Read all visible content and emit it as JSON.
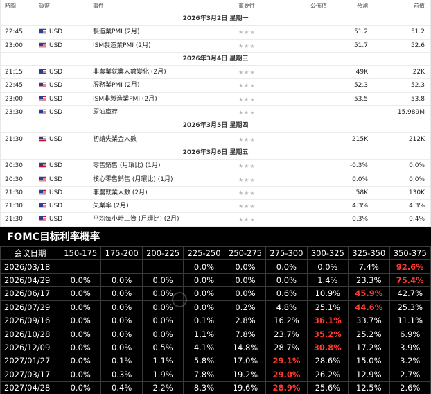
{
  "calendar": {
    "headers": {
      "time": "時間",
      "currency": "貨幣",
      "event": "事件",
      "importance": "重要性",
      "actual": "公佈值",
      "forecast": "預測",
      "previous": "前值"
    },
    "importance_glyph": "★★★",
    "rows": [
      {
        "type": "date",
        "label": "2026年3月2日 星期一"
      },
      {
        "type": "event",
        "time": "22:45",
        "currency": "USD",
        "event": "製造業PMI (2月)",
        "actual": "",
        "forecast": "51.2",
        "previous": "51.2"
      },
      {
        "type": "event",
        "time": "23:00",
        "currency": "USD",
        "event": "ISM製造業PMI (2月)",
        "actual": "",
        "forecast": "51.7",
        "previous": "52.6"
      },
      {
        "type": "date",
        "label": "2026年3月4日 星期三"
      },
      {
        "type": "event",
        "time": "21:15",
        "currency": "USD",
        "event": "非農業就業人數變化 (2月)",
        "actual": "",
        "forecast": "49K",
        "previous": "22K"
      },
      {
        "type": "event",
        "time": "22:45",
        "currency": "USD",
        "event": "服務業PMI (2月)",
        "actual": "",
        "forecast": "52.3",
        "previous": "52.3"
      },
      {
        "type": "event",
        "time": "23:00",
        "currency": "USD",
        "event": "ISM非製造業PMI (2月)",
        "actual": "",
        "forecast": "53.5",
        "previous": "53.8"
      },
      {
        "type": "event",
        "time": "23:30",
        "currency": "USD",
        "event": "原油庫存",
        "actual": "",
        "forecast": "",
        "previous": "15.989M"
      },
      {
        "type": "date",
        "label": "2026年3月5日 星期四"
      },
      {
        "type": "event",
        "time": "21:30",
        "currency": "USD",
        "event": "初請失業金人數",
        "actual": "",
        "forecast": "215K",
        "previous": "212K"
      },
      {
        "type": "date",
        "label": "2026年3月6日 星期五"
      },
      {
        "type": "event",
        "time": "20:30",
        "currency": "USD",
        "event": "零售銷售 (月環比) (1月)",
        "actual": "",
        "forecast": "-0.3%",
        "previous": "0.0%"
      },
      {
        "type": "event",
        "time": "20:30",
        "currency": "USD",
        "event": "核心零售銷售 (月環比) (1月)",
        "actual": "",
        "forecast": "0.0%",
        "previous": "0.0%"
      },
      {
        "type": "event",
        "time": "21:30",
        "currency": "USD",
        "event": "非農就業人數 (2月)",
        "actual": "",
        "forecast": "58K",
        "previous": "130K"
      },
      {
        "type": "event",
        "time": "21:30",
        "currency": "USD",
        "event": "失業率 (2月)",
        "actual": "",
        "forecast": "4.3%",
        "previous": "4.3%"
      },
      {
        "type": "event",
        "time": "21:30",
        "currency": "USD",
        "event": "平均每小時工資 (月環比) (2月)",
        "actual": "",
        "forecast": "0.3%",
        "previous": "0.4%"
      }
    ]
  },
  "fomc": {
    "title": "FOMC目标利率概率",
    "highlight_color": "#ff3b30",
    "columns": [
      "会议日期",
      "150-175",
      "175-200",
      "200-225",
      "225-250",
      "250-275",
      "275-300",
      "300-325",
      "325-350",
      "350-375"
    ],
    "rows": [
      {
        "date": "2026/03/18",
        "cells": [
          "",
          "",
          "",
          "0.0%",
          "0.0%",
          "0.0%",
          "0.0%",
          "7.4%",
          "92.6%"
        ],
        "hi": 8
      },
      {
        "date": "2026/04/29",
        "cells": [
          "0.0%",
          "0.0%",
          "0.0%",
          "0.0%",
          "0.0%",
          "0.0%",
          "1.4%",
          "23.3%",
          "75.4%"
        ],
        "hi": 8
      },
      {
        "date": "2026/06/17",
        "cells": [
          "0.0%",
          "0.0%",
          "0.0%",
          "0.0%",
          "0.0%",
          "0.6%",
          "10.9%",
          "45.9%",
          "42.7%"
        ],
        "hi": 7
      },
      {
        "date": "2026/07/29",
        "cells": [
          "0.0%",
          "0.0%",
          "0.0%",
          "0.0%",
          "0.2%",
          "4.8%",
          "25.1%",
          "44.6%",
          "25.3%"
        ],
        "hi": 7
      },
      {
        "date": "2026/09/16",
        "cells": [
          "0.0%",
          "0.0%",
          "0.0%",
          "0.1%",
          "2.8%",
          "16.2%",
          "36.1%",
          "33.7%",
          "11.1%"
        ],
        "hi": 6
      },
      {
        "date": "2026/10/28",
        "cells": [
          "0.0%",
          "0.0%",
          "0.0%",
          "1.1%",
          "7.8%",
          "23.7%",
          "35.2%",
          "25.2%",
          "6.9%"
        ],
        "hi": 6
      },
      {
        "date": "2026/12/09",
        "cells": [
          "0.0%",
          "0.0%",
          "0.5%",
          "4.1%",
          "14.8%",
          "28.7%",
          "30.8%",
          "17.2%",
          "3.9%"
        ],
        "hi": 6
      },
      {
        "date": "2027/01/27",
        "cells": [
          "0.0%",
          "0.1%",
          "1.1%",
          "5.8%",
          "17.0%",
          "29.1%",
          "28.6%",
          "15.0%",
          "3.2%"
        ],
        "hi": 5
      },
      {
        "date": "2027/03/17",
        "cells": [
          "0.0%",
          "0.3%",
          "1.9%",
          "7.8%",
          "19.2%",
          "29.0%",
          "26.2%",
          "12.9%",
          "2.7%"
        ],
        "hi": 5
      },
      {
        "date": "2027/04/28",
        "cells": [
          "0.0%",
          "0.4%",
          "2.2%",
          "8.3%",
          "19.6%",
          "28.9%",
          "25.6%",
          "12.5%",
          "2.6%"
        ],
        "hi": 5
      }
    ]
  }
}
